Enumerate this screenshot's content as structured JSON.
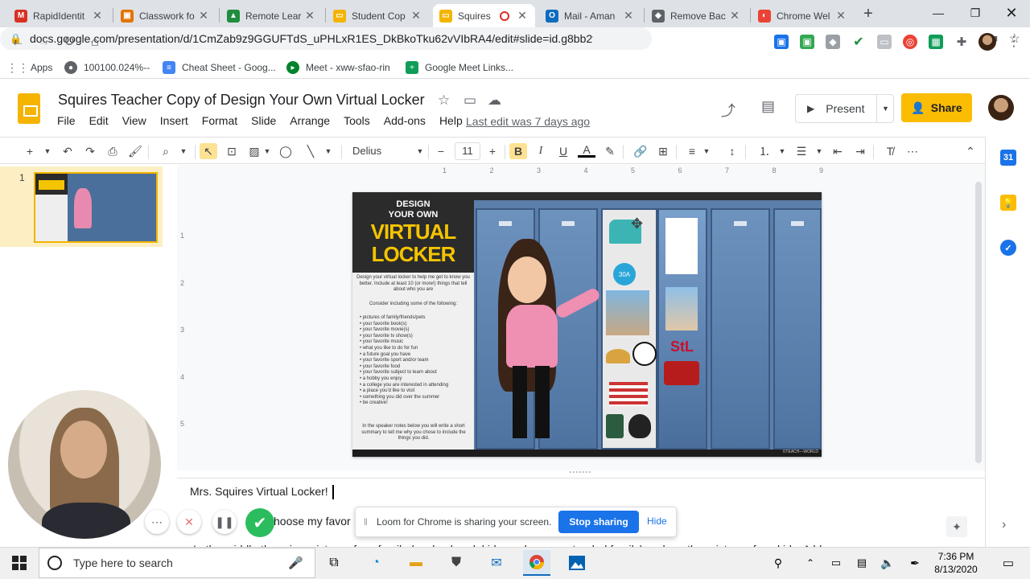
{
  "browser": {
    "tabs": [
      {
        "title": "RapidIdentit",
        "color": "#d93025",
        "glyph": "M"
      },
      {
        "title": "Classwork fo",
        "color": "#e37400",
        "glyph": "▣"
      },
      {
        "title": "Remote Lear",
        "color": "#1e8e3e",
        "glyph": "▲"
      },
      {
        "title": "Student Cop",
        "color": "#f4b400",
        "glyph": "▭"
      },
      {
        "title": "Squires",
        "color": "#f4b400",
        "glyph": "▭",
        "active": true
      },
      {
        "title": "Mail - Aman",
        "color": "#0f6cbd",
        "glyph": "O"
      },
      {
        "title": "Remove Bac",
        "color": "#5f6368",
        "glyph": "◆"
      },
      {
        "title": "Chrome Wel",
        "color": "#ea4335",
        "glyph": "◐"
      }
    ],
    "url": "docs.google.com/presentation/d/1CmZab9z9GGUFTdS_uPHLxR1ES_DkBkoTku62vVIbRA4/edit#slide=id.g8bb2ff...",
    "bookmarks": [
      {
        "label": "Apps",
        "color": "#ea4335"
      },
      {
        "label": "100100.024%--",
        "color": "#5f6368"
      },
      {
        "label": "Cheat Sheet - Goog...",
        "color": "#4285f4"
      },
      {
        "label": "Meet - xww-sfao-rin",
        "color": "#00832d"
      },
      {
        "label": "Google Meet Links...",
        "color": "#0f9d58"
      }
    ]
  },
  "slides": {
    "title": "Squires Teacher Copy of Design Your Own Virtual Locker",
    "menu": [
      "File",
      "Edit",
      "View",
      "Insert",
      "Format",
      "Slide",
      "Arrange",
      "Tools",
      "Add-ons",
      "Help"
    ],
    "last_edit": "Last edit was 7 days ago",
    "present_label": "Present",
    "share_label": "Share",
    "font_name": "Delius",
    "font_size": "11",
    "slide_number": "1",
    "ruler_top": [
      "1",
      "2",
      "3",
      "4",
      "5",
      "6",
      "7",
      "8",
      "9"
    ],
    "ruler_left": [
      "1",
      "2",
      "3",
      "4",
      "5"
    ]
  },
  "slide_content": {
    "heading_line1": "DESIGN",
    "heading_line2": "YOUR OWN",
    "heading_line3": "VIRTUAL",
    "heading_line4": "LOCKER",
    "intro": "Design your virtual locker to help me get to know you better. Include at least 10 (or more!) things that tell about who you are",
    "consider": "Consider including some of the following:",
    "bullets": [
      "pictures of family/friends/pets",
      "your favorite book(s)",
      "your favorite movie(s)",
      "your favorite tv show(s)",
      "your favorite music",
      "what you like to do for fun",
      "a future goal you have",
      "your favorite sport and/or team",
      "your favorite food",
      "your favorite subject to learn about",
      "a hobby you enjoy",
      "a college you are interested in attending",
      "a place you'd like to visit",
      "something you did over the summer",
      "be creative!"
    ],
    "outro": "In the speaker notes below you will write a short summary to tell me why you chose to include the things you did.",
    "credit": "©TEACH—WORLD"
  },
  "notes": {
    "line1": "Mrs. Squires Virtual Locker!",
    "line2": "hoose my favor",
    "line3": "In the middle there is a picture of my family (my husband, kids, and some extended family) and another picture of my kids. A bl"
  },
  "loom": {
    "message": "Loom for Chrome is sharing your screen.",
    "stop_label": "Stop sharing",
    "hide_label": "Hide"
  },
  "taskbar": {
    "search_placeholder": "Type here to search",
    "time": "7:36 PM",
    "date": "8/13/2020"
  }
}
